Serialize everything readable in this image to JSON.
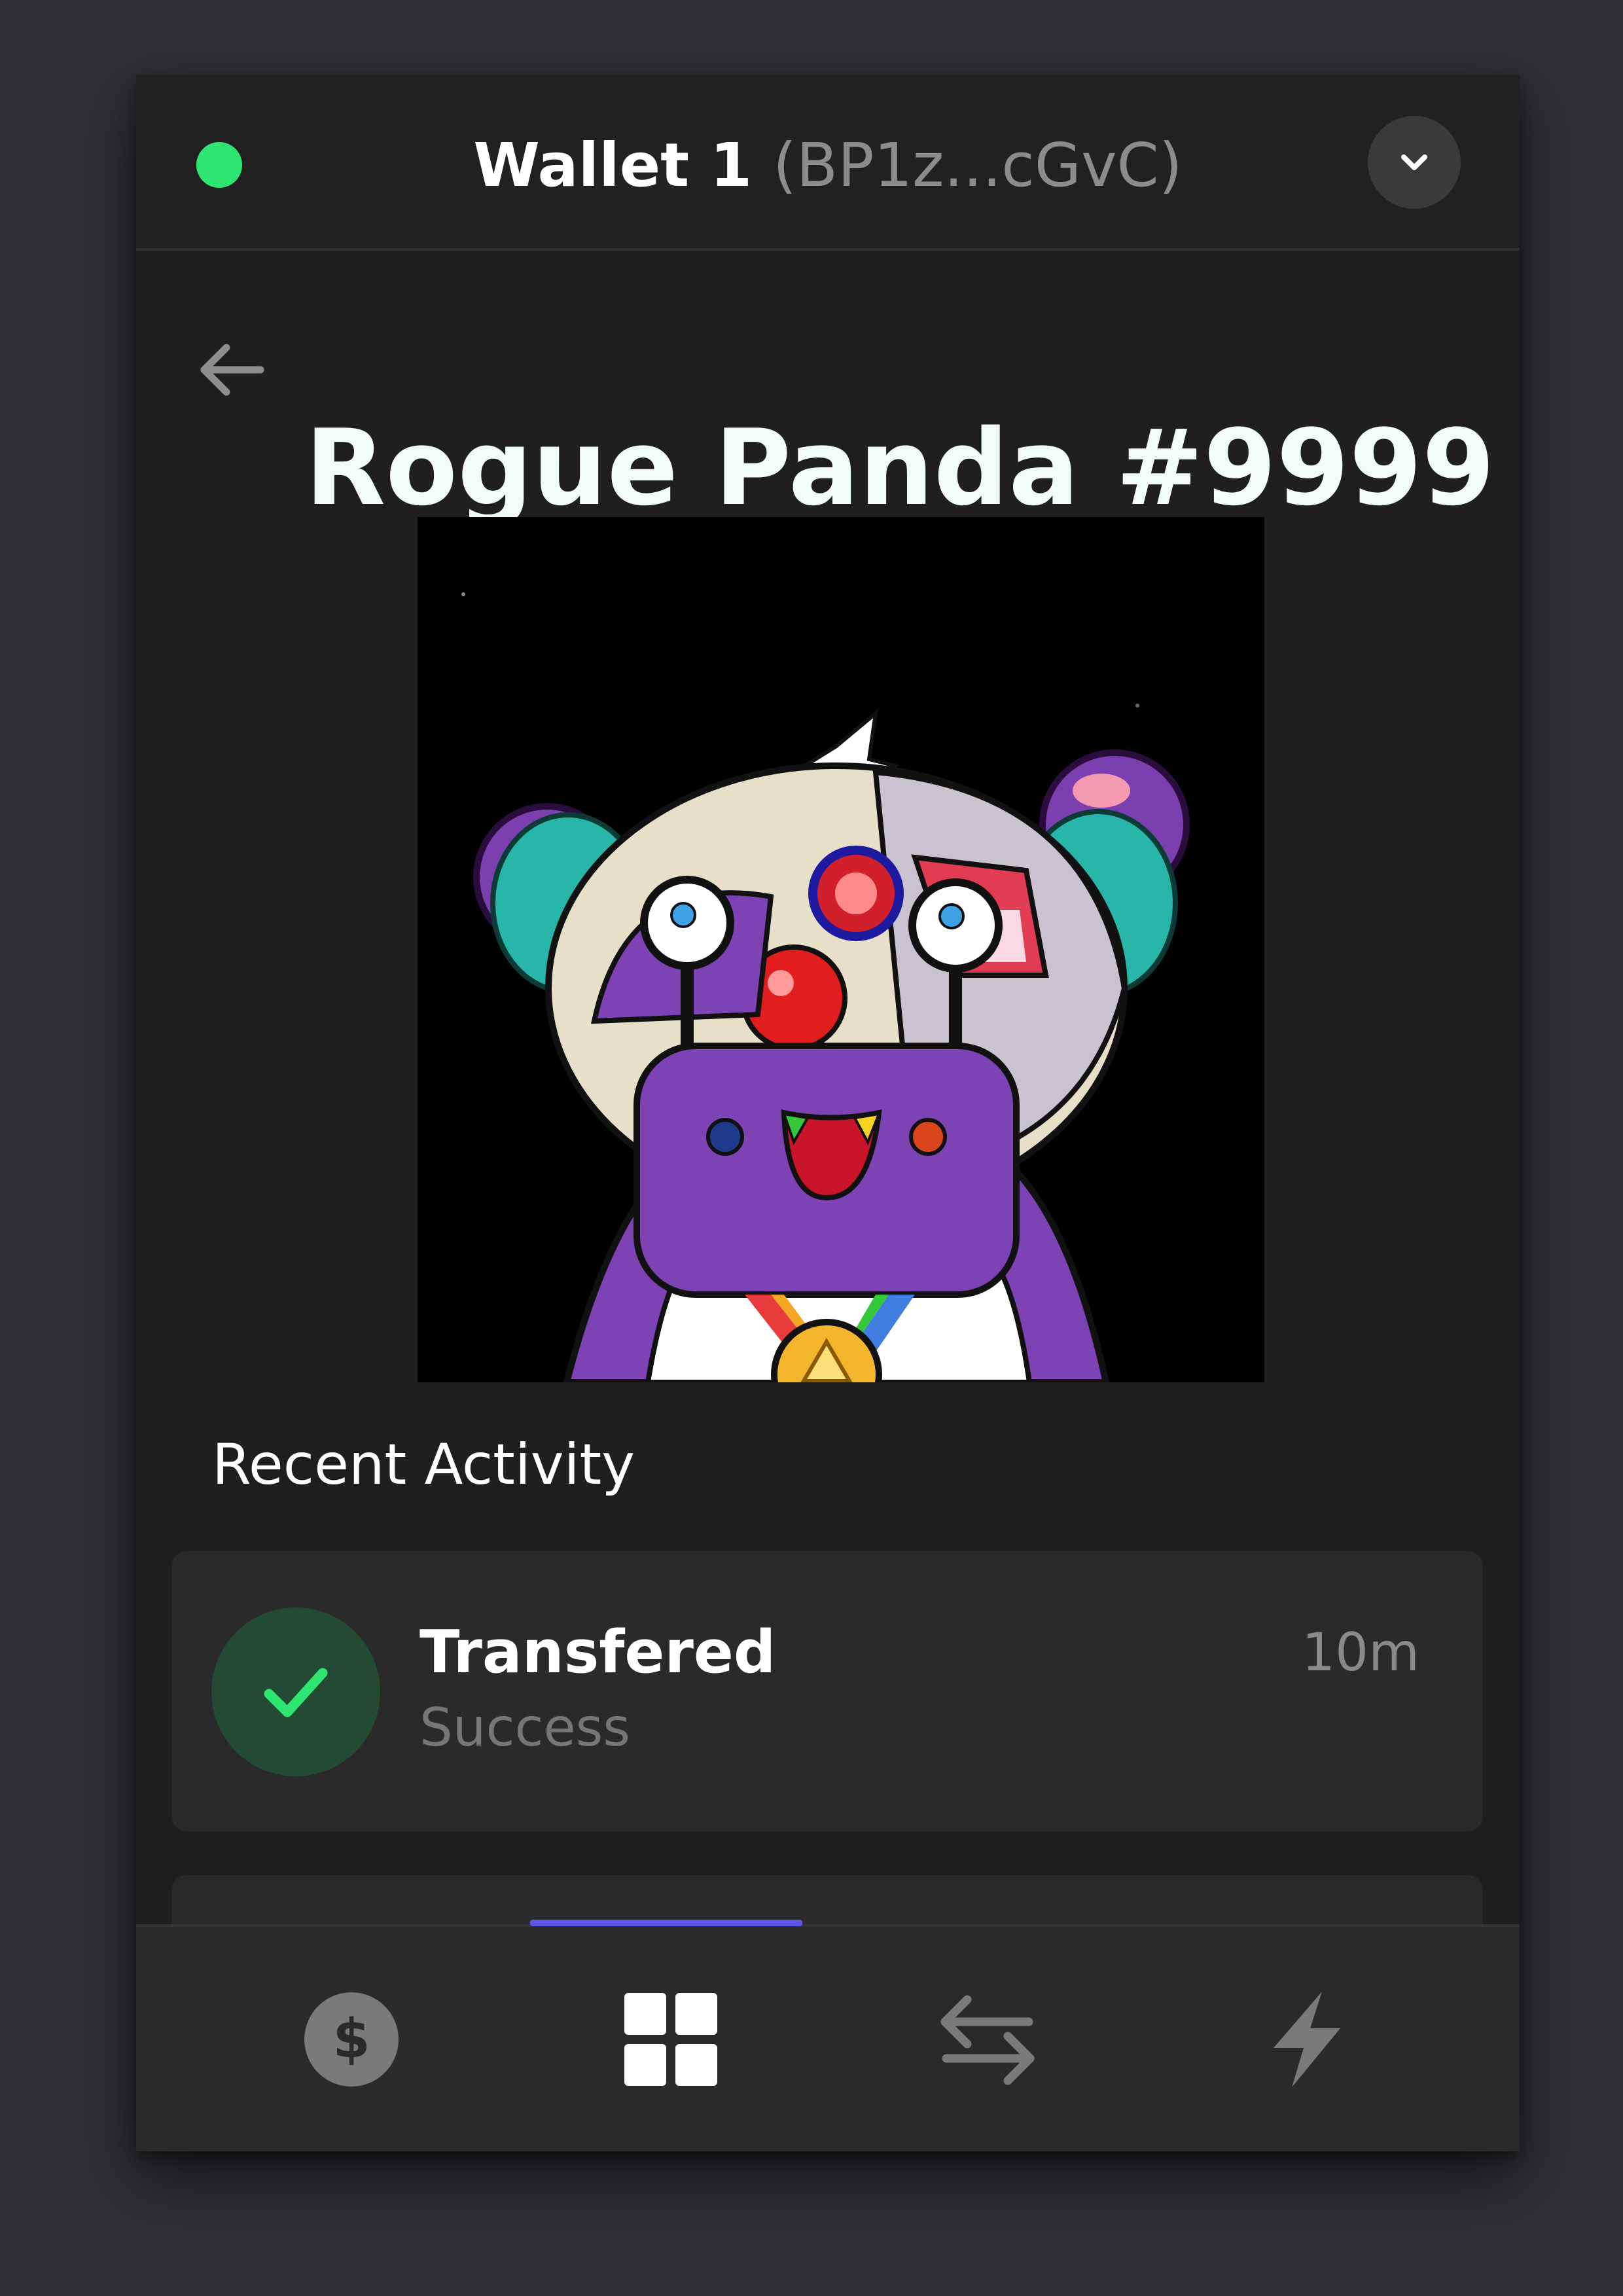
{
  "header": {
    "wallet_name": "Wallet 1",
    "wallet_address": "(BP1z...cGvC)",
    "status_color": "#2ee572"
  },
  "detail": {
    "title": "Rogue Panda #9999",
    "image_alt": "Rogue Panda #9999"
  },
  "activity": {
    "section_title": "Recent Activity",
    "items": [
      {
        "label": "Transfered",
        "status": "Success",
        "time": "10m",
        "icon": "check-icon",
        "status_color": "#2ee572"
      }
    ]
  },
  "tabs": [
    {
      "name": "balances",
      "icon": "dollar-icon",
      "active": false
    },
    {
      "name": "collectibles",
      "icon": "grid-icon",
      "active": true
    },
    {
      "name": "swap",
      "icon": "swap-arrows-icon",
      "active": false
    },
    {
      "name": "activity",
      "icon": "lightning-icon",
      "active": false
    }
  ],
  "colors": {
    "accent": "#5f55e6",
    "background": "#1f1f20",
    "card": "#2a2a2b"
  }
}
